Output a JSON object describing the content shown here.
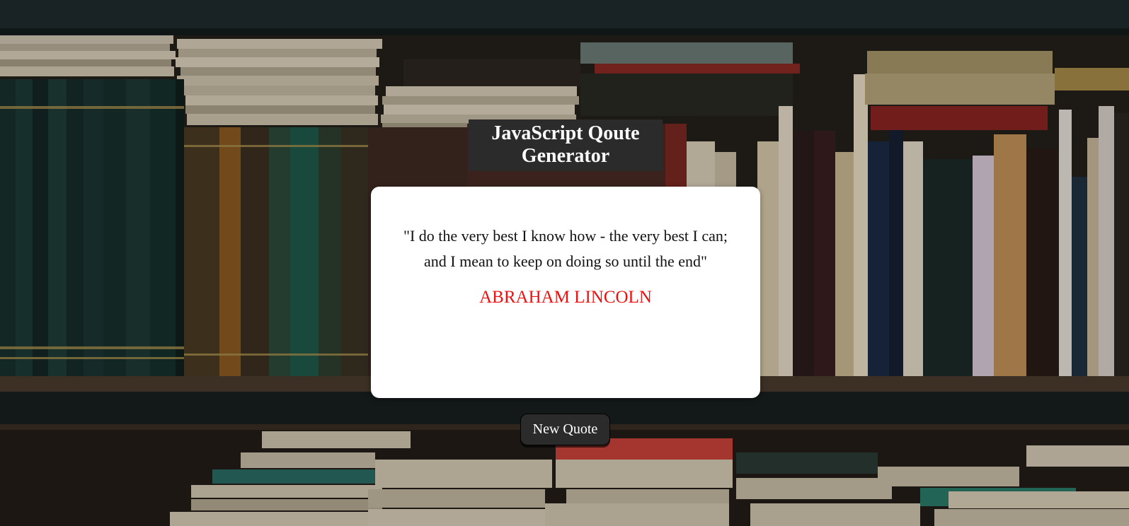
{
  "heading": {
    "title": "JavaScript Qoute Generator"
  },
  "quote": {
    "text": "\"I do the very best I know how - the very best I can; and I mean to keep on doing so until the end\"",
    "author": "ABRAHAM LINCOLN"
  },
  "controls": {
    "new_quote_label": "New Quote"
  },
  "colors": {
    "title_bg": "#2b2b2b",
    "card_bg": "#ffffff",
    "author_color": "#ee1111",
    "button_bg": "#2b2b2b"
  }
}
